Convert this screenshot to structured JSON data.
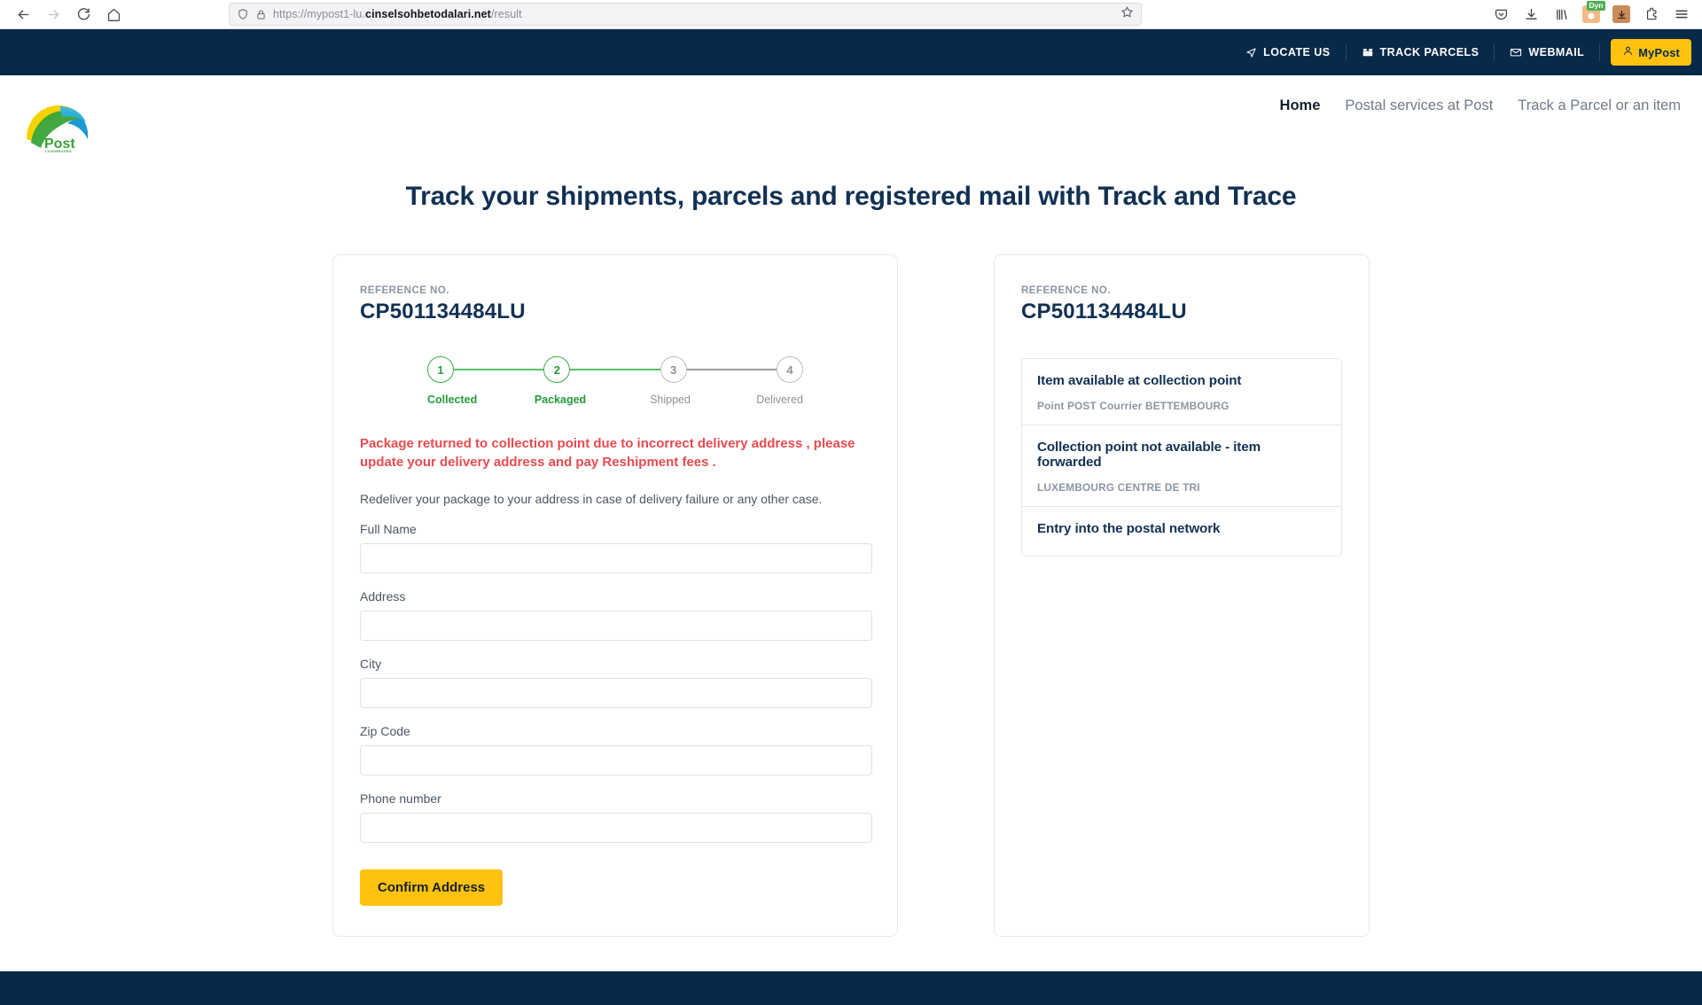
{
  "browser": {
    "url_prefix": "https://mypost1-lu.",
    "url_domain": "cinselsohbetodalari.net",
    "url_suffix": "/result",
    "back_icon": "back-arrow-icon",
    "forward_icon": "forward-arrow-icon",
    "reload_icon": "reload-icon",
    "home_icon": "home-icon",
    "shield_icon": "shield-icon",
    "lock_icon": "lock-icon",
    "bookmark_icon": "star-icon",
    "pocket_icon": "pocket-icon",
    "downloads_icon": "download-icon",
    "library_icon": "library-icon",
    "extension_badge_label": "Dyn",
    "extensions_icon": "extension-icon",
    "menu_icon": "hamburger-menu-icon"
  },
  "topbar": {
    "links": [
      {
        "label": "LOCATE US",
        "icon": "location-arrow-icon"
      },
      {
        "label": "TRACK PARCELS",
        "icon": "parcel-box-icon"
      },
      {
        "label": "WEBMAIL",
        "icon": "envelope-icon"
      }
    ],
    "mypost_label": "MyPost",
    "mypost_icon": "user-icon",
    "background": "#07294a",
    "accent": "#ffc20e"
  },
  "header": {
    "logo_text": "Post",
    "logo_subtext": "LUXEMBOURG",
    "nav": [
      {
        "label": "Home",
        "active": true
      },
      {
        "label": "Postal services at Post",
        "active": false
      },
      {
        "label": "Track a Parcel or an item",
        "active": false
      }
    ]
  },
  "page": {
    "title": "Track your shipments, parcels and registered mail with Track and Trace"
  },
  "left_card": {
    "reference_label": "REFERENCE NO.",
    "reference_value": "CP501134484LU",
    "stepper": {
      "steps": [
        {
          "number": "1",
          "label": "Collected",
          "done": true
        },
        {
          "number": "2",
          "label": "Packaged",
          "done": true
        },
        {
          "number": "3",
          "label": "Shipped",
          "done": false
        },
        {
          "number": "4",
          "label": "Delivered",
          "done": false
        }
      ],
      "segments": [
        true,
        true,
        false
      ],
      "done_color": "#249a3b",
      "pending_color": "#8b939b"
    },
    "alert_text": "Package returned to collection point due to incorrect delivery address , please update your delivery address and pay Reshipment fees .",
    "alert_color": "#ea4a4f",
    "helper_text": "Redeliver your package to your address in case of delivery failure or any other case.",
    "fields": [
      {
        "label": "Full Name",
        "value": "",
        "placeholder": ""
      },
      {
        "label": "Address",
        "value": "",
        "placeholder": ""
      },
      {
        "label": "City",
        "value": "",
        "placeholder": ""
      },
      {
        "label": "Zip Code",
        "value": "",
        "placeholder": ""
      },
      {
        "label": "Phone number",
        "value": "",
        "placeholder": ""
      }
    ],
    "submit_label": "Confirm Address"
  },
  "right_card": {
    "reference_label": "REFERENCE NO.",
    "reference_value": "CP501134484LU",
    "history": [
      {
        "title": "Item available at collection point",
        "detail": "Point POST Courrier BETTEMBOURG"
      },
      {
        "title": "Collection point not available - item forwarded",
        "detail": "LUXEMBOURG CENTRE DE TRI"
      },
      {
        "title": "Entry into the postal network",
        "detail": ""
      }
    ]
  },
  "footer": {
    "background": "#07294a"
  }
}
